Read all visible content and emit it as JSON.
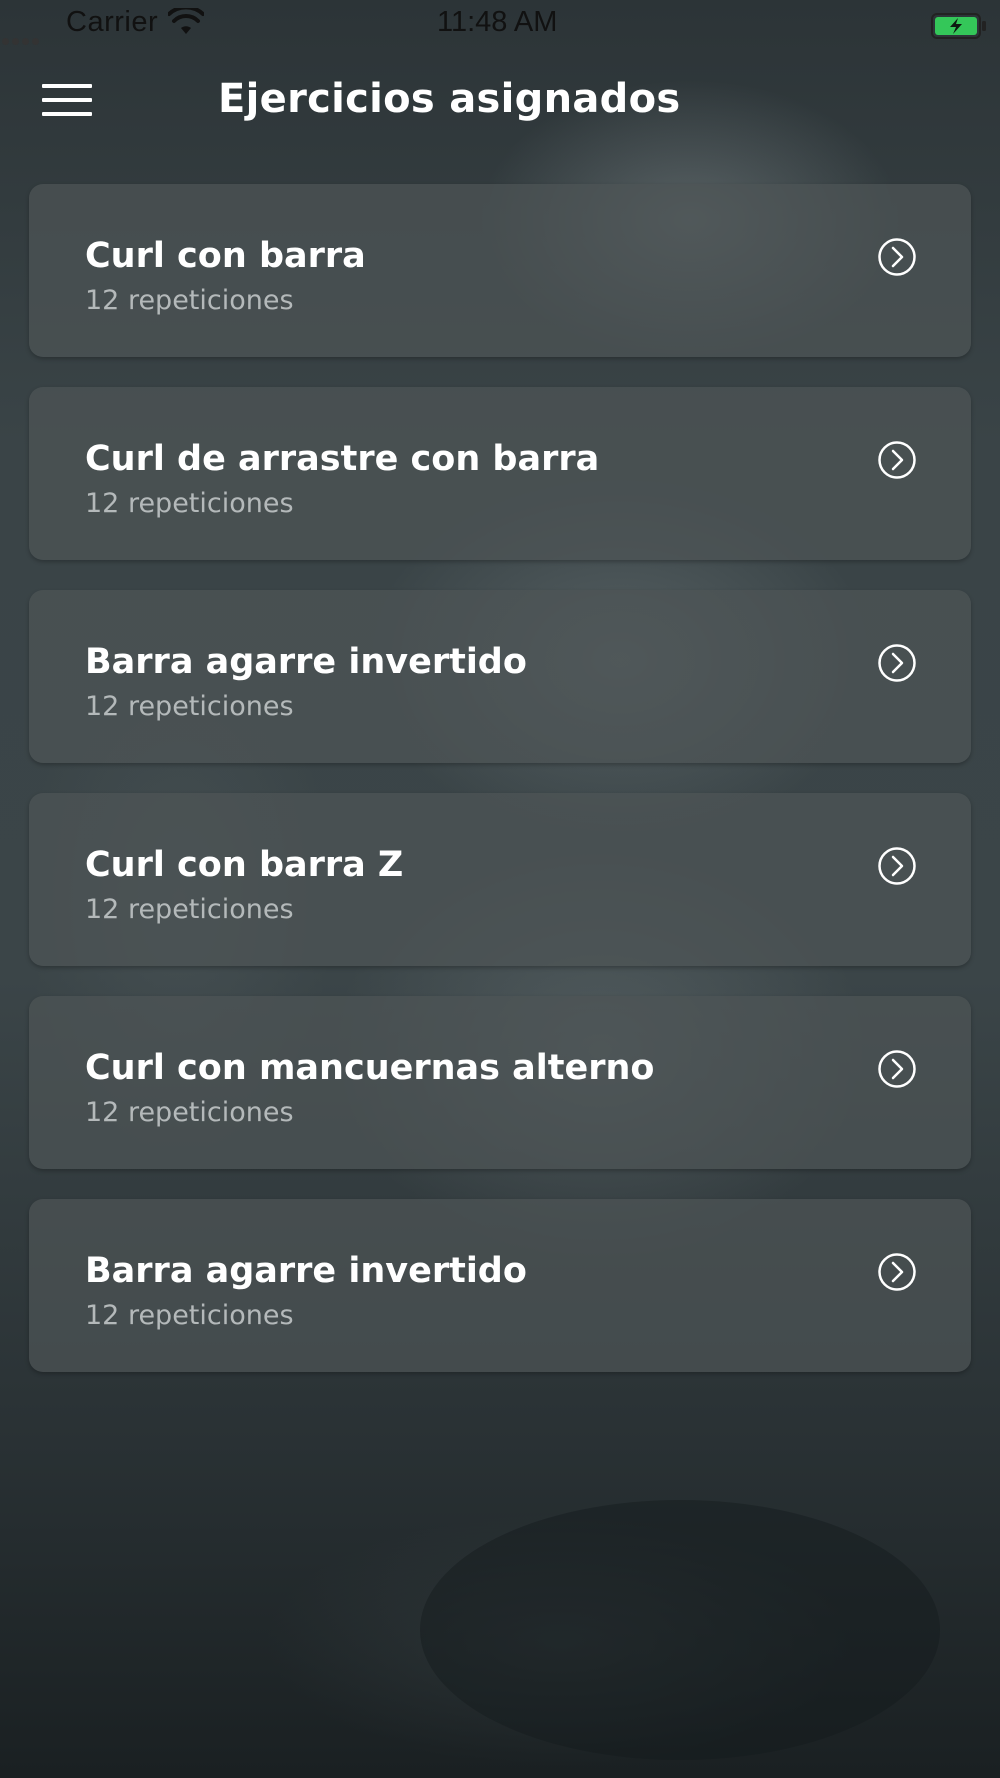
{
  "status_bar": {
    "carrier": "Carrier",
    "time": "11:48 AM",
    "icons": [
      "signal-dots-icon",
      "wifi-icon",
      "battery-charging-icon"
    ],
    "battery_color": "#34c759"
  },
  "header": {
    "menu_icon": "hamburger-menu-icon",
    "title": "Ejercicios asignados"
  },
  "exercises": [
    {
      "name": "Curl con barra",
      "reps": "12 repeticiones"
    },
    {
      "name": "Curl de arrastre con barra",
      "reps": "12 repeticiones"
    },
    {
      "name": "Barra agarre invertido",
      "reps": "12 repeticiones"
    },
    {
      "name": "Curl con barra Z",
      "reps": "12 repeticiones"
    },
    {
      "name": "Curl con mancuernas alterno",
      "reps": "12 repeticiones"
    },
    {
      "name": "Barra agarre invertido",
      "reps": "12 repeticiones"
    }
  ],
  "card_icon": "chevron-right-circle-icon",
  "colors": {
    "card_background": "rgba(78,84,86,0.72)",
    "title_text": "#ffffff",
    "subtitle_text": "#b4b9ba"
  }
}
